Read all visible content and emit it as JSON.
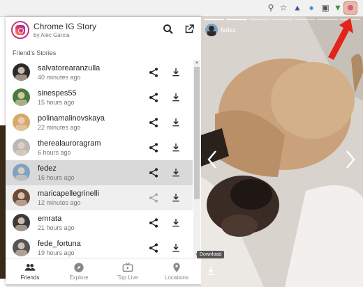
{
  "app": {
    "title": "Chrome IG Story",
    "author": "by Alec Garcia"
  },
  "section_title": "Friend's Stories",
  "stories": [
    {
      "username": "salvatorearanzulla",
      "time": "40 minutes ago"
    },
    {
      "username": "sinespes55",
      "time": "15 hours ago"
    },
    {
      "username": "polinamalinovskaya",
      "time": "22 minutes ago"
    },
    {
      "username": "therealauroragram",
      "time": "6 hours ago"
    },
    {
      "username": "fedez",
      "time": "16 hours ago"
    },
    {
      "username": "maricapellegrinelli",
      "time": "12 minutes ago"
    },
    {
      "username": "emrata",
      "time": "21 hours ago"
    },
    {
      "username": "fede_fortuna",
      "time": "19 hours ago"
    }
  ],
  "selected_username": "fedez",
  "hovered_username": "maricapellegrinelli",
  "nav": [
    {
      "label": "Friends",
      "icon": "people-icon",
      "active": true
    },
    {
      "label": "Explore",
      "icon": "compass-icon",
      "active": false
    },
    {
      "label": "Top Live",
      "icon": "live-tv-icon",
      "active": false
    },
    {
      "label": "Locations",
      "icon": "location-pin-icon",
      "active": false
    }
  ],
  "viewer": {
    "username": "fedez",
    "tooltip": "Download"
  },
  "colors": {
    "accent": "#c13584",
    "selected_row": "#d9d9d9",
    "annotation_arrow": "#e2231a"
  }
}
